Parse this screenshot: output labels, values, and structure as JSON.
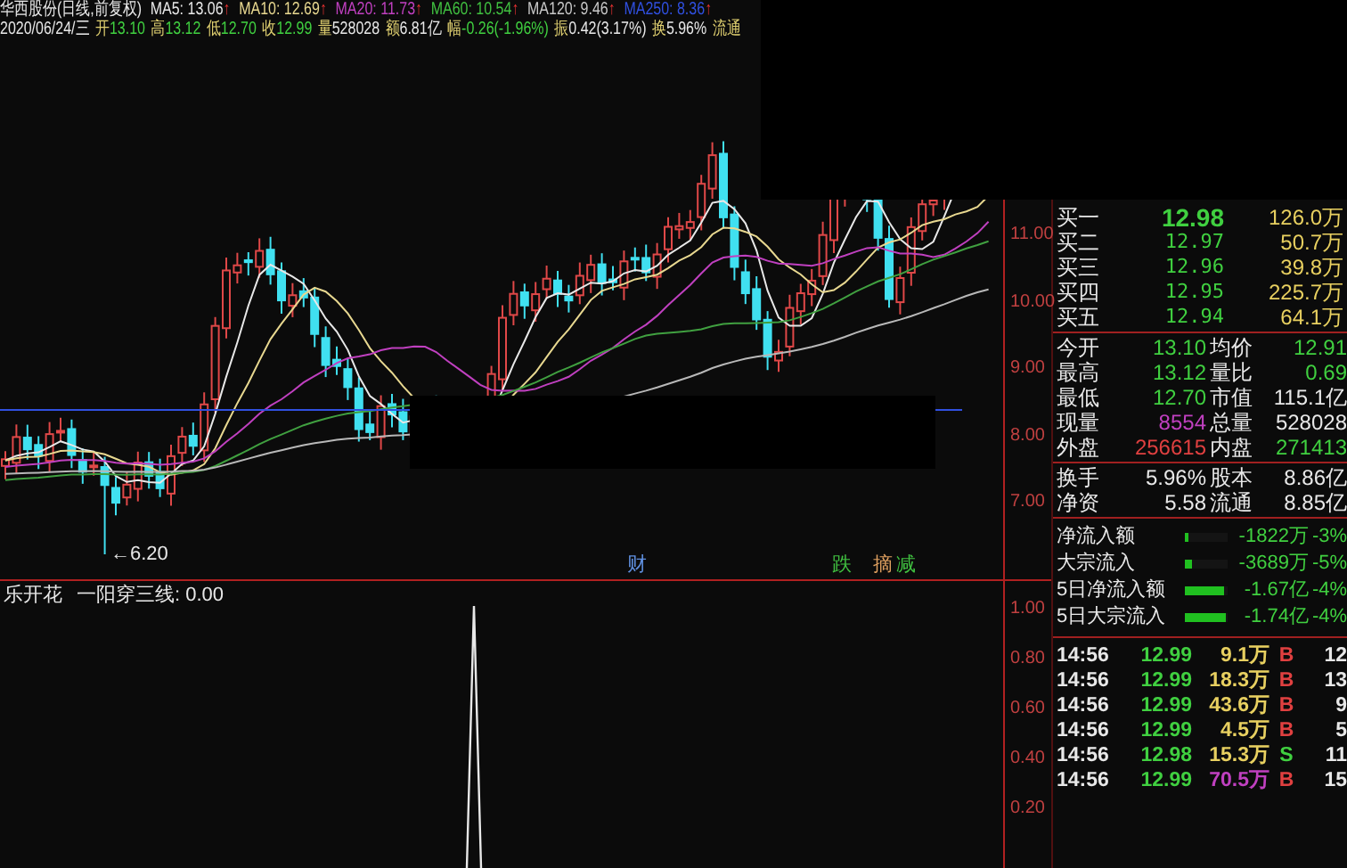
{
  "header": {
    "title": "华西股份(日线,前复权)",
    "averages": [
      {
        "label": "MA5: 13.06",
        "arrow": "↑",
        "color": "#e8e8e8"
      },
      {
        "label": "MA10: 12.69",
        "arrow": "↑",
        "color": "#e8d890"
      },
      {
        "label": "MA20: 11.73",
        "arrow": "↑",
        "color": "#c040c0"
      },
      {
        "label": "MA60: 10.54",
        "arrow": "↑",
        "color": "#40c040"
      },
      {
        "label": "MA120: 9.46",
        "arrow": "↑",
        "color": "#c8c8c8"
      },
      {
        "label": "MA250: 8.36",
        "arrow": "↑",
        "color": "#3050e0"
      }
    ],
    "date": "2020/06/24/三",
    "quote": [
      {
        "label": "开",
        "value": "13.10",
        "color": "#40d040"
      },
      {
        "label": "高",
        "value": "13.12",
        "color": "#40d040"
      },
      {
        "label": "低",
        "value": "12.70",
        "color": "#40d040"
      },
      {
        "label": "收",
        "value": "12.99",
        "color": "#40d040"
      },
      {
        "label": "量",
        "value": "528028",
        "color": "#e8e8e8"
      },
      {
        "label": "额",
        "value": "6.81亿",
        "color": "#e8e8e8"
      },
      {
        "label": "幅",
        "value": "-0.26(-1.96%)",
        "color": "#40d040"
      },
      {
        "label": "振",
        "value": "0.42(3.17%)",
        "color": "#e8e8e8"
      },
      {
        "label": "换",
        "value": "5.96%",
        "color": "#e8e8e8"
      },
      {
        "label": "流通"
      }
    ]
  },
  "price_axis": [
    "11.00",
    "10.00",
    "9.00",
    "8.00",
    "7.00"
  ],
  "low_marker": "←6.20",
  "events": [
    {
      "text": "财",
      "color": "#6090e0"
    },
    {
      "text": "跌",
      "color": "#40c040"
    },
    {
      "text": "摘",
      "color": "#e0a060"
    },
    {
      "text": "减",
      "color": "#40c040"
    }
  ],
  "indicator": {
    "name": "乐开花",
    "reading": "一阳穿三线: 0.00"
  },
  "indicator_axis": [
    "1.00",
    "0.80",
    "0.60",
    "0.40",
    "0.20"
  ],
  "bids": [
    {
      "label": "买一",
      "price": "12.98",
      "volume": "126.0万"
    },
    {
      "label": "买二",
      "price": "12.97",
      "volume": "50.7万"
    },
    {
      "label": "买三",
      "price": "12.96",
      "volume": "39.8万"
    },
    {
      "label": "买四",
      "price": "12.95",
      "volume": "225.7万"
    },
    {
      "label": "买五",
      "price": "12.94",
      "volume": "64.1万"
    }
  ],
  "stats": [
    [
      {
        "label": "今开",
        "value": "13.10",
        "color": "#40d040"
      },
      {
        "label": "均价",
        "value": "12.91",
        "color": "#40d040"
      }
    ],
    [
      {
        "label": "最高",
        "value": "13.12",
        "color": "#40d040"
      },
      {
        "label": "量比",
        "value": "0.69",
        "color": "#40d040"
      }
    ],
    [
      {
        "label": "最低",
        "value": "12.70",
        "color": "#40d040"
      },
      {
        "label": "市值",
        "value": "115.1亿",
        "color": "#e8e8e8"
      }
    ],
    [
      {
        "label": "现量",
        "value": "8554",
        "color": "#c040c0"
      },
      {
        "label": "总量",
        "value": "528028",
        "color": "#e8e8e8"
      }
    ],
    [
      {
        "label": "外盘",
        "value": "256615",
        "color": "#e04040"
      },
      {
        "label": "内盘",
        "value": "271413",
        "color": "#40d040"
      }
    ]
  ],
  "shares": [
    [
      {
        "label": "换手",
        "value": "5.96%",
        "color": "#e8e8e8"
      },
      {
        "label": "股本",
        "value": "8.86亿",
        "color": "#e8e8e8"
      }
    ],
    [
      {
        "label": "净资",
        "value": "5.58",
        "color": "#e8e8e8"
      },
      {
        "label": "流通",
        "value": "8.85亿",
        "color": "#e8e8e8"
      }
    ]
  ],
  "flows": [
    {
      "label": "净流入额",
      "level": 0.08,
      "value": "-1822万",
      "percent": "-3%"
    },
    {
      "label": "大宗流入",
      "level": 0.18,
      "value": "-3689万",
      "percent": "-5%"
    },
    {
      "label": "5日净流入额",
      "level": 0.92,
      "value": "-1.67亿",
      "percent": "-4%"
    },
    {
      "label": "5日大宗流入",
      "level": 0.96,
      "value": "-1.74亿",
      "percent": "-4%"
    }
  ],
  "trades": [
    {
      "time": "14:56",
      "price": "12.99",
      "volume": "9.1万",
      "color": "#e8d060",
      "side": "B",
      "kind": "buy",
      "count": "12"
    },
    {
      "time": "14:56",
      "price": "12.99",
      "volume": "18.3万",
      "color": "#e8d060",
      "side": "B",
      "kind": "buy",
      "count": "13"
    },
    {
      "time": "14:56",
      "price": "12.99",
      "volume": "43.6万",
      "color": "#e8d060",
      "side": "B",
      "kind": "buy",
      "count": "9"
    },
    {
      "time": "14:56",
      "price": "12.99",
      "volume": "4.5万",
      "color": "#e8d060",
      "side": "B",
      "kind": "buy",
      "count": "5"
    },
    {
      "time": "14:56",
      "price": "12.98",
      "volume": "15.3万",
      "color": "#e8d060",
      "side": "S",
      "kind": "sell",
      "count": "11"
    },
    {
      "time": "14:56",
      "price": "12.99",
      "volume": "70.5万",
      "color": "#c040c0",
      "side": "B",
      "kind": "buy",
      "count": "15"
    }
  ]
}
